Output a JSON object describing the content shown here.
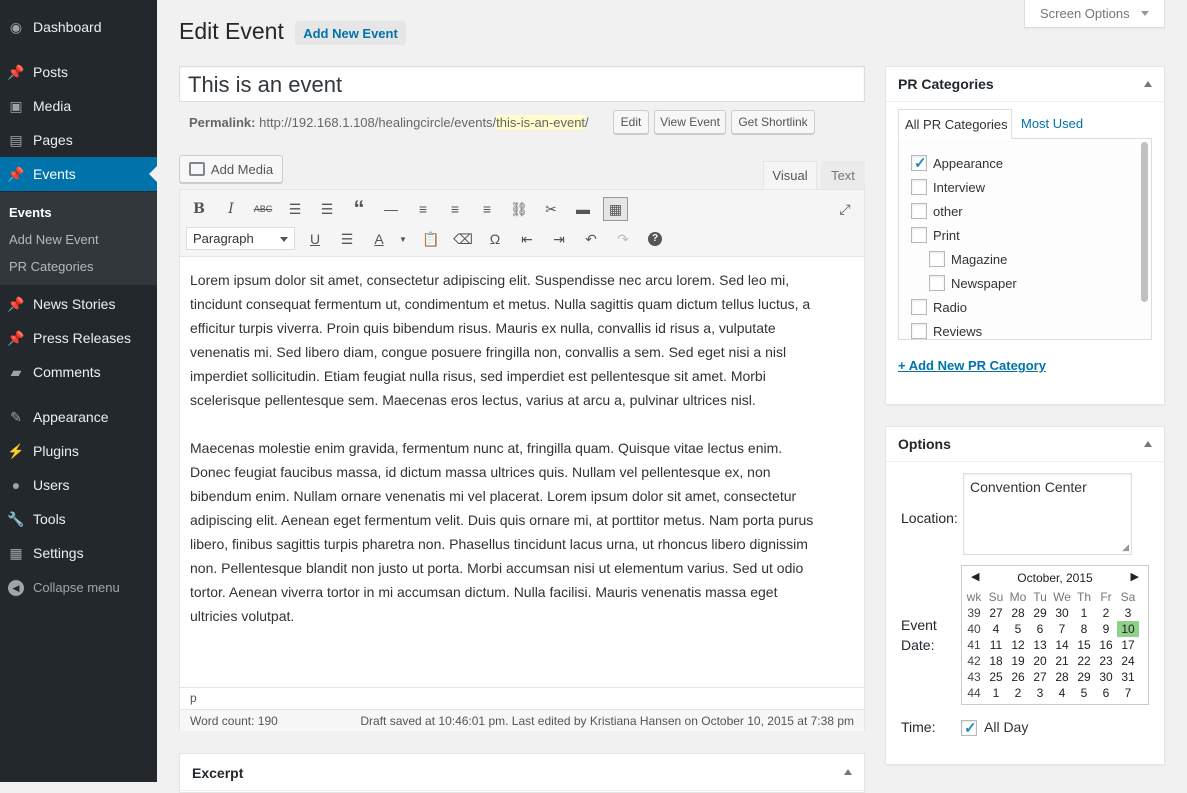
{
  "sidebar": {
    "items": [
      {
        "label": "Dashboard",
        "icon": "dashboard-icon"
      },
      {
        "label": "Posts",
        "icon": "pin-icon"
      },
      {
        "label": "Media",
        "icon": "media-icon"
      },
      {
        "label": "Pages",
        "icon": "pages-icon"
      },
      {
        "label": "Events",
        "icon": "pin-icon"
      },
      {
        "label": "News Stories",
        "icon": "pin-icon"
      },
      {
        "label": "Press Releases",
        "icon": "pin-icon"
      },
      {
        "label": "Comments",
        "icon": "comment-icon"
      },
      {
        "label": "Appearance",
        "icon": "brush-icon"
      },
      {
        "label": "Plugins",
        "icon": "plugin-icon"
      },
      {
        "label": "Users",
        "icon": "user-icon"
      },
      {
        "label": "Tools",
        "icon": "wrench-icon"
      },
      {
        "label": "Settings",
        "icon": "settings-icon"
      }
    ],
    "submenu": [
      "Events",
      "Add New Event",
      "PR Categories"
    ],
    "collapse": "Collapse menu"
  },
  "header": {
    "title": "Edit Event",
    "add_new": "Add New Event",
    "screen_options": "Screen Options"
  },
  "post": {
    "title": "This is an event",
    "permalink_label": "Permalink:",
    "permalink_base": "http://192.168.1.108/healingcircle/events/",
    "permalink_slug": "this-is-an-event",
    "permalink_end": "/",
    "edit_btn": "Edit",
    "view_btn": "View Event",
    "shortlink_btn": "Get Shortlink"
  },
  "editor": {
    "add_media": "Add Media",
    "tab_visual": "Visual",
    "tab_text": "Text",
    "format": "Paragraph",
    "para1": "Lorem ipsum dolor sit amet, consectetur adipiscing elit. Suspendisse nec arcu lorem. Sed leo mi, tincidunt consequat fermentum ut, condimentum et metus. Nulla sagittis quam dictum tellus luctus, a efficitur turpis viverra. Proin quis bibendum risus. Mauris ex nulla, convallis id risus a, vulputate venenatis mi. Sed libero diam, congue posuere fringilla non, convallis a sem. Sed eget nisi a nisl imperdiet sollicitudin. Etiam feugiat nulla risus, sed imperdiet est pellentesque sit amet. Morbi scelerisque pellentesque sem. Maecenas eros lectus, varius at arcu a, pulvinar ultrices nisl.",
    "para2": "Maecenas molestie enim gravida, fermentum nunc at, fringilla quam. Quisque vitae lectus enim. Donec feugiat faucibus massa, id dictum massa ultrices quis. Nullam vel pellentesque ex, non bibendum enim. Nullam ornare venenatis mi vel placerat. Lorem ipsum dolor sit amet, consectetur adipiscing elit. Aenean eget fermentum velit. Duis quis ornare mi, at porttitor metus. Nam porta purus libero, finibus sagittis turpis pharetra non. Phasellus tincidunt lacus urna, ut rhoncus libero dignissim non. Pellentesque blandit non justo ut porta. Morbi accumsan nisi ut elementum varius. Sed ut odio tortor. Aenean viverra tortor in mi accumsan dictum. Nulla facilisi. Mauris venenatis massa eget ultricies volutpat.",
    "path": "p",
    "word_count": "Word count: 190",
    "draft_status": "Draft saved at 10:46:01 pm. Last edited by Kristiana Hansen on October 10, 2015 at 7:38 pm"
  },
  "excerpt": {
    "title": "Excerpt"
  },
  "pr_categories": {
    "title": "PR Categories",
    "tab_all": "All PR Categories",
    "tab_used": "Most Used",
    "items": [
      {
        "label": "Appearance",
        "checked": true
      },
      {
        "label": "Interview",
        "checked": false
      },
      {
        "label": "other",
        "checked": false
      },
      {
        "label": "Print",
        "checked": false
      },
      {
        "label": "Magazine",
        "checked": false
      },
      {
        "label": "Newspaper",
        "checked": false
      },
      {
        "label": "Radio",
        "checked": false
      },
      {
        "label": "Reviews",
        "checked": false
      }
    ],
    "add_new": "+ Add New PR Category"
  },
  "options": {
    "title": "Options",
    "location_label": "Location:",
    "location_value": "Convention Center",
    "date_label": "Event Date:",
    "time_label": "Time:",
    "allday_label": "All Day",
    "allday_checked": true,
    "calendar": {
      "month": "October, 2015",
      "prev": "◀",
      "next": "▶",
      "headers": [
        "wk",
        "Su",
        "Mo",
        "Tu",
        "We",
        "Th",
        "Fr",
        "Sa"
      ],
      "weeks": [
        [
          "39",
          "27",
          "28",
          "29",
          "30",
          "1",
          "2",
          "3"
        ],
        [
          "40",
          "4",
          "5",
          "6",
          "7",
          "8",
          "9",
          "10"
        ],
        [
          "41",
          "11",
          "12",
          "13",
          "14",
          "15",
          "16",
          "17"
        ],
        [
          "42",
          "18",
          "19",
          "20",
          "21",
          "22",
          "23",
          "24"
        ],
        [
          "43",
          "25",
          "26",
          "27",
          "28",
          "29",
          "30",
          "31"
        ],
        [
          "44",
          "1",
          "2",
          "3",
          "4",
          "5",
          "6",
          "7"
        ]
      ],
      "selected": "10",
      "selected_color": "#8fd18a"
    }
  },
  "colors": {
    "accent": "#0073aa",
    "sidebar": "#23282d",
    "slug_highlight": "#fffbcc"
  }
}
